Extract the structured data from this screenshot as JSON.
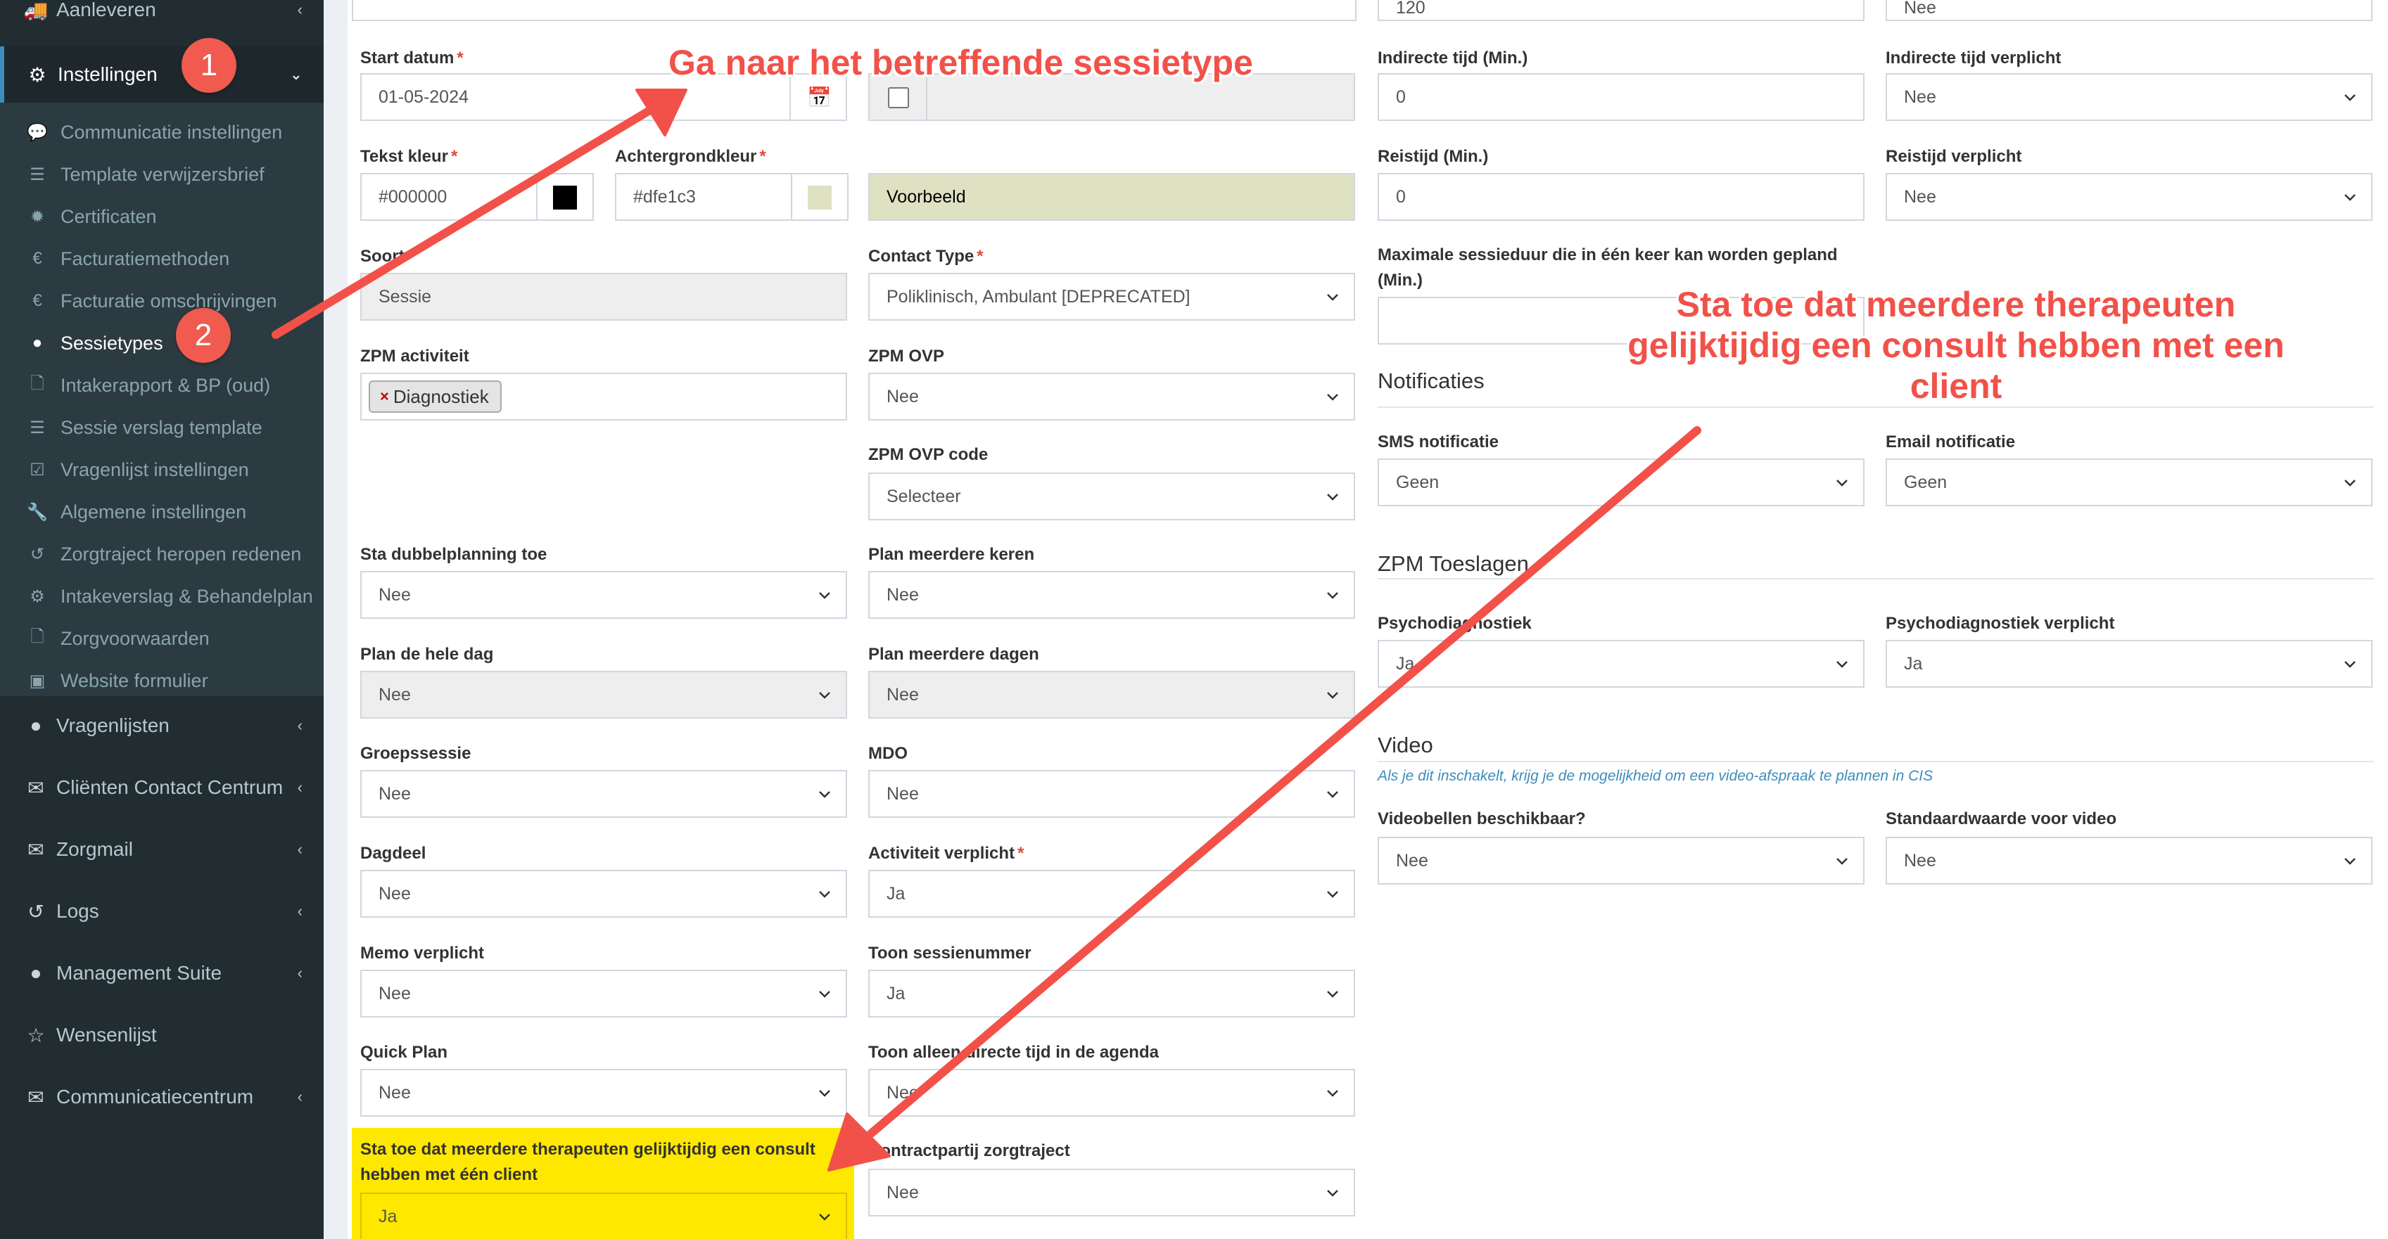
{
  "sidebar": {
    "aanleveren": "Aanleveren",
    "instellingen": "Instellingen",
    "sub_items": [
      {
        "label": "Communicatie instellingen",
        "icon": "comments-icon"
      },
      {
        "label": "Template verwijzersbrief",
        "icon": "list-icon"
      },
      {
        "label": "Certificaten",
        "icon": "certificate-icon"
      },
      {
        "label": "Facturatiemethoden",
        "icon": "euro-icon"
      },
      {
        "label": "Facturatie omschrijvingen",
        "icon": "euro-icon"
      },
      {
        "label": "Sessietypes",
        "icon": "globe-icon"
      },
      {
        "label": "Intakerapport & BP (oud)",
        "icon": "file-icon"
      },
      {
        "label": "Sessie verslag template",
        "icon": "list-icon"
      },
      {
        "label": "Vragenlijst instellingen",
        "icon": "check-square-icon"
      },
      {
        "label": "Algemene instellingen",
        "icon": "wrench-icon"
      },
      {
        "label": "Zorgtraject heropen redenen",
        "icon": "undo-icon"
      },
      {
        "label": "Intakeverslag & Behandelplan",
        "icon": "gear-icon"
      },
      {
        "label": "Zorgvoorwaarden",
        "icon": "file-icon"
      },
      {
        "label": "Website formulier",
        "icon": "suitcase-icon"
      }
    ],
    "top_items": [
      {
        "label": "Vragenlijsten",
        "icon": "globe-icon"
      },
      {
        "label": "Cliënten Contact Centrum",
        "icon": "envelope-icon"
      },
      {
        "label": "Zorgmail",
        "icon": "envelope-icon"
      },
      {
        "label": "Logs",
        "icon": "undo-icon"
      },
      {
        "label": "Management Suite",
        "icon": "globe-icon"
      },
      {
        "label": "Wensenlijst",
        "icon": "star-icon"
      },
      {
        "label": "Communicatiecentrum",
        "icon": "envelope-icon"
      }
    ],
    "badge1": "1",
    "badge2": "2"
  },
  "top_partial": {
    "field_120": "120",
    "field_nee": "Nee"
  },
  "form": {
    "start_datum": {
      "label": "Start datum",
      "value": "01-05-2024"
    },
    "tekst_kleur": {
      "label": "Tekst kleur",
      "value": "#000000",
      "swatch": "#000000"
    },
    "achtergrondkleur": {
      "label": "Achtergrondkleur",
      "value": "#dfe1c3",
      "swatch": "#dfe1c3"
    },
    "voorbeeld": "Voorbeeld",
    "soort": {
      "label": "Soort",
      "value": "Sessie"
    },
    "contact_type": {
      "label": "Contact Type",
      "value": "Poliklinisch, Ambulant [DEPRECATED]"
    },
    "zpm_activiteit": {
      "label": "ZPM activiteit",
      "tag": "Diagnostiek",
      "tag_x": "×"
    },
    "zpm_ovp": {
      "label": "ZPM OVP",
      "value": "Nee"
    },
    "zpm_ovp_code": {
      "label": "ZPM OVP code",
      "value": "Selecteer"
    },
    "sta_dubbelplanning": {
      "label": "Sta dubbelplanning toe",
      "value": "Nee"
    },
    "plan_meerdere_keren": {
      "label": "Plan meerdere keren",
      "value": "Nee"
    },
    "plan_hele_dag": {
      "label": "Plan de hele dag",
      "value": "Nee"
    },
    "plan_meerdere_dagen": {
      "label": "Plan meerdere dagen",
      "value": "Nee"
    },
    "groepssessie": {
      "label": "Groepssessie",
      "value": "Nee"
    },
    "mdo": {
      "label": "MDO",
      "value": "Nee"
    },
    "dagdeel": {
      "label": "Dagdeel",
      "value": "Nee"
    },
    "activiteit_verplicht": {
      "label": "Activiteit verplicht",
      "value": "Ja"
    },
    "memo_verplicht": {
      "label": "Memo verplicht",
      "value": "Nee"
    },
    "toon_sessienummer": {
      "label": "Toon sessienummer",
      "value": "Ja"
    },
    "quick_plan": {
      "label": "Quick Plan",
      "value": "Nee"
    },
    "toon_alleen_directe": {
      "label": "Toon alleen directe tijd in de agenda",
      "value": "Nee"
    },
    "sta_meerdere_therapeuten": {
      "label_line1": "Sta toe dat meerdere therapeuten gelijktijdig een consult",
      "label_line2": "hebben met één client",
      "value": "Ja"
    },
    "contractpartij": {
      "label": "Contractpartij zorgtraject",
      "value": "Nee"
    },
    "indirecte_tijd": {
      "label": "Indirecte tijd (Min.)",
      "value": "0"
    },
    "indirecte_tijd_verplicht": {
      "label": "Indirecte tijd verplicht",
      "value": "Nee"
    },
    "reistijd": {
      "label": "Reistijd (Min.)",
      "value": "0"
    },
    "reistijd_verplicht": {
      "label": "Reistijd verplicht",
      "value": "Nee"
    },
    "max_sessieduur": {
      "label_line1": "Maximale sessieduur die in één keer kan worden gepland",
      "label_line2": "(Min.)",
      "value": ""
    },
    "notificaties_title": "Notificaties",
    "sms_notificatie": {
      "label": "SMS notificatie",
      "value": "Geen"
    },
    "email_notificatie": {
      "label": "Email notificatie",
      "value": "Geen"
    },
    "zpm_toeslagen_title": "ZPM Toeslagen",
    "psychodiagnostiek": {
      "label": "Psychodiagnostiek",
      "value": "Ja"
    },
    "psychodiagnostiek_verplicht": {
      "label": "Psychodiagnostiek verplicht",
      "value": "Ja"
    },
    "video_title": "Video",
    "video_help": "Als je dit inschakelt, krijg je de mogelijkheid om een video-afspraak te plannen in CIS",
    "videobellen": {
      "label": "Videobellen beschikbaar?",
      "value": "Nee"
    },
    "standaardwaarde_video": {
      "label": "Standaardwaarde voor video",
      "value": "Nee"
    }
  },
  "annotations": {
    "top": "Ga naar het betreffende sessietype",
    "right_line1": "Sta toe dat meerdere therapeuten",
    "right_line2": "gelijktijdig een consult hebben met een",
    "right_line3": "client"
  },
  "colors": {
    "sidebar_bg": "#222d32",
    "accent": "#3c8dbc",
    "annotation": "#f25149",
    "highlight": "#ffe800",
    "required": "#dd4b39"
  }
}
